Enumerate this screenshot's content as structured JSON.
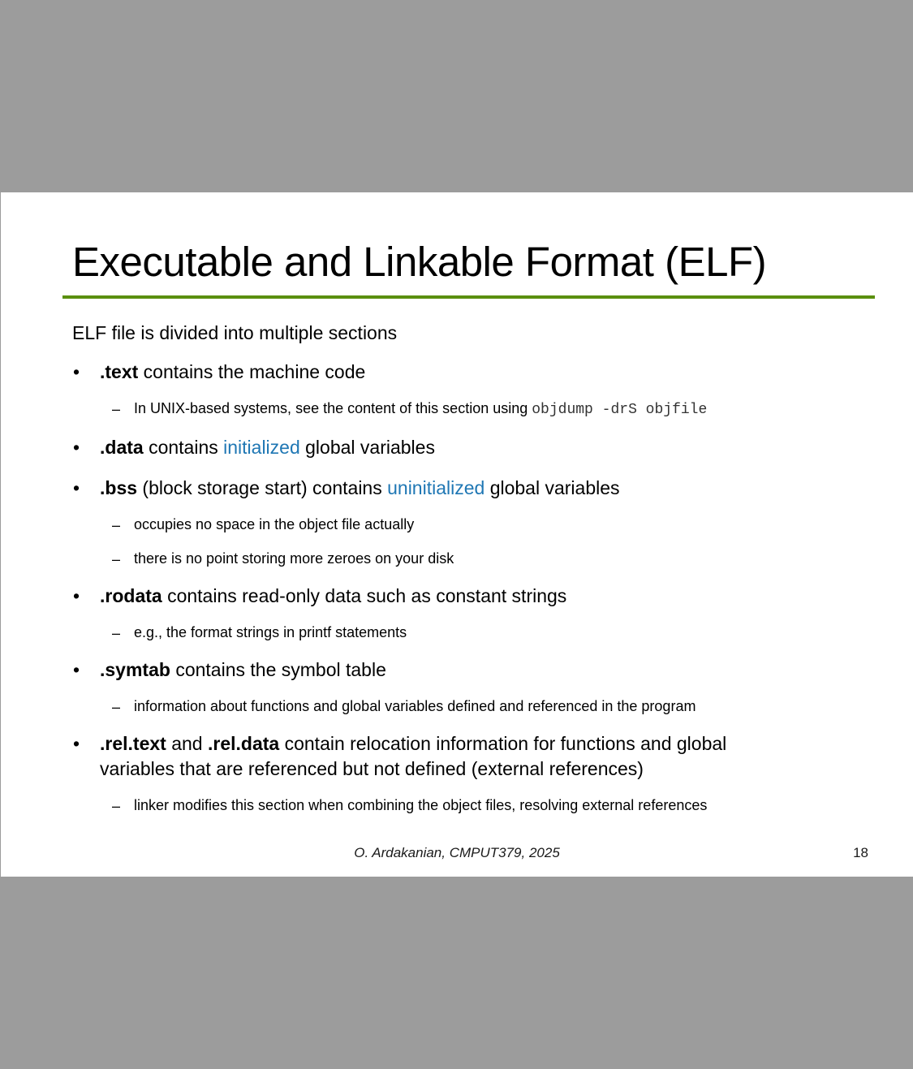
{
  "slide": {
    "title": "Executable and Linkable Format (ELF)",
    "intro": "ELF file is divided into multiple sections",
    "accent_color": "#5a8f0e",
    "highlight_color": "#1f77b4",
    "bullets": {
      "text": {
        "keyword": ".text",
        "rest": " contains the machine code"
      },
      "text_sub": {
        "lead": "In UNIX-based systems, see the content of this section using ",
        "code": "objdump -drS objfile"
      },
      "data": {
        "keyword": ".data",
        "before": " contains ",
        "highlight": "initialized",
        "after": " global variables"
      },
      "bss": {
        "keyword": ".bss",
        "before": " (block storage start) contains ",
        "highlight": "uninitialized",
        "after": " global variables"
      },
      "bss_sub1": "occupies no space in the object file actually",
      "bss_sub2": "there is no point storing more zeroes on your disk",
      "rodata": {
        "keyword": ".rodata",
        "rest": " contains read-only data such as constant strings"
      },
      "rodata_sub": "e.g., the format strings in printf statements",
      "symtab": {
        "keyword": ".symtab",
        "rest": " contains the symbol table"
      },
      "symtab_sub": "information about functions and global variables defined and referenced in the program",
      "rel": {
        "keyword1": ".rel.text",
        "mid": " and ",
        "keyword2": ".rel.data",
        "rest_line1": " contain relocation information for functions and global",
        "line2": "variables that are referenced but not defined (external references)"
      },
      "rel_sub": "linker modifies this section when combining the object files, resolving external references"
    },
    "bullet_glyph": "•",
    "dash_glyph": "–",
    "footer": "O. Ardakanian, CMPUT379, 2025",
    "page_number": "18"
  }
}
